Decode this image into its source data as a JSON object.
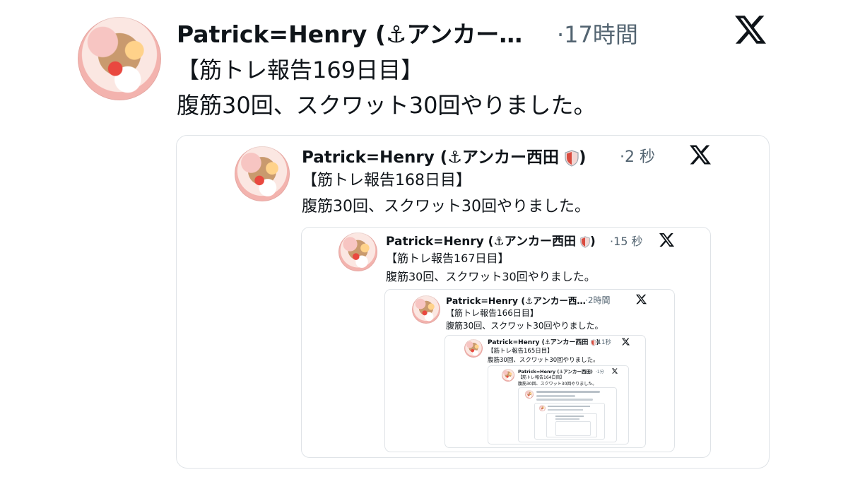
{
  "icons": {
    "x_logo": "x-logo-icon",
    "anchor": "anchor-icon",
    "shield": "shield-icon",
    "avatar": "avatar-image"
  },
  "colors": {
    "text": "#0f1419",
    "muted": "#536471",
    "border": "#dfe3e7",
    "shield_red": "#d94b3f"
  },
  "main": {
    "name": "Patrick=Henry (",
    "anchor_glyph": "⚓",
    "name_rest": "アンカー…",
    "separator": "·",
    "time": "17時間",
    "title": "【筋トレ報告169日目】",
    "body": "腹筋30回、スクワット30回やりました。"
  },
  "quote1": {
    "name": "Patrick=Henry (",
    "anchor_glyph": "⚓",
    "name_rest": "アンカー西田",
    "close": ")",
    "separator": "·",
    "time": "2 秒",
    "title": "【筋トレ報告168日目】",
    "body": "腹筋30回、スクワット30回やりました。"
  },
  "quote2": {
    "name": "Patrick=Henry (",
    "anchor_glyph": "⚓",
    "name_rest": "アンカー西田",
    "close": ")",
    "separator": "·",
    "time": "15 秒",
    "title": "【筋トレ報告167日目】",
    "body": "腹筋30回、スクワット30回やりました。"
  },
  "quote3": {
    "name": "Patrick=Henry (",
    "anchor_glyph": "⚓",
    "name_rest": "アンカー西…",
    "separator": "·",
    "time": "2時間",
    "title": "【筋トレ報告166日目】",
    "body": "腹筋30回、スクワット30回やりました。"
  },
  "quote4": {
    "name": "Patrick=Henry (",
    "anchor_glyph": "⚓",
    "name_rest": "アンカー西田",
    "close": ")",
    "separator": "·",
    "time": "11秒",
    "title": "【筋トレ報告165日目】",
    "body": "腹筋30回、スクワット30回やりました。"
  },
  "quote5": {
    "name": "Patrick=Henry (",
    "anchor_glyph": "⚓",
    "name_rest": "アンカー西田",
    "close": ")",
    "separator": "·",
    "time": "1分",
    "title": "【筋トレ報告164日目】",
    "body": "腹筋30回、スクワット30回やりました。"
  }
}
